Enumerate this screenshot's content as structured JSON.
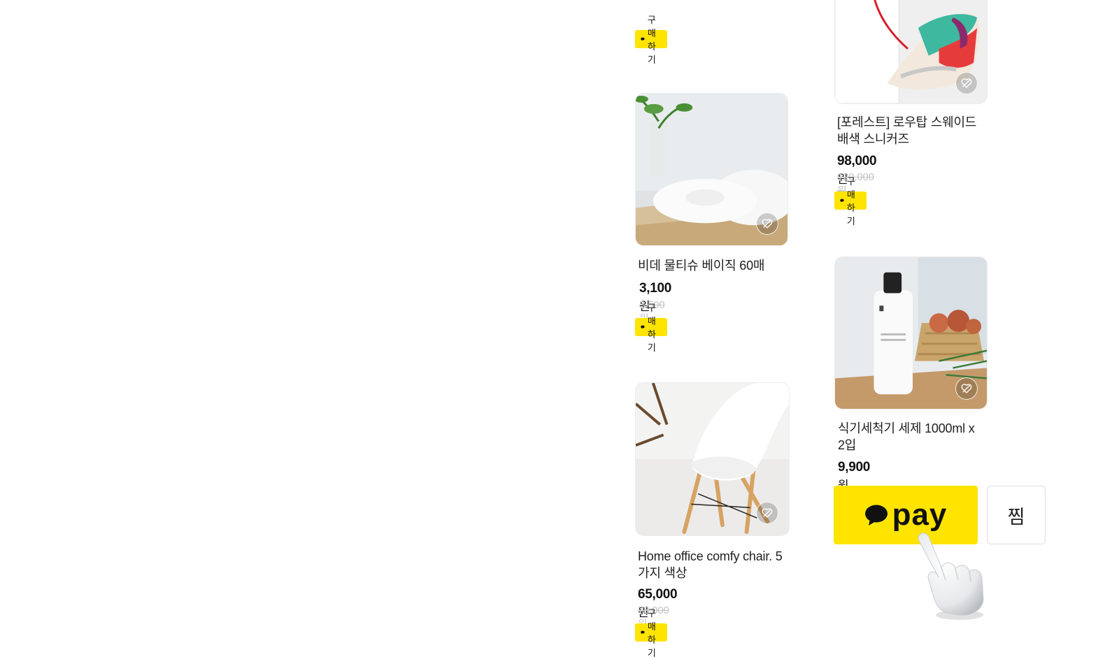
{
  "colors": {
    "accent": "#ffe400",
    "strike": "#c4c4c4"
  },
  "buy_label": "구매하기",
  "products": [
    {
      "name": "",
      "price": "",
      "currency": "",
      "original_price": ""
    },
    {
      "name": "비데 물티슈 베이직 60매",
      "price": "3,100",
      "currency": "원",
      "original_price": "3,500원"
    },
    {
      "name": "Home office comfy chair. 5가지 색상",
      "price": "65,000",
      "currency": "원",
      "original_price": "78,000원"
    },
    {
      "name": "[포레스트] 로우탑 스웨이드 배색 스니커즈",
      "price": "98,000",
      "currency": "원",
      "original_price": "120,000원"
    },
    {
      "name": "식기세척기 세제 1000ml x 2입",
      "price": "9,900",
      "currency": "원",
      "original_price": ""
    }
  ],
  "bottom_bar": {
    "pay_label": "pay",
    "zzim_label": "찜"
  },
  "icons": {
    "buy": "speech-bubble-icon",
    "wish": "heart-icon",
    "pay": "speech-bubble-icon",
    "pointer": "pointing-hand-icon"
  }
}
